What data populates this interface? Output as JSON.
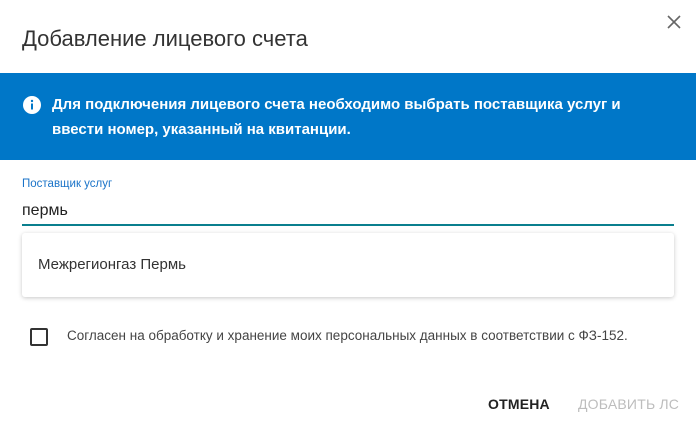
{
  "dialog": {
    "title": "Добавление лицевого счета",
    "info_text": "Для подключения лицевого счета необходимо выбрать поставщика услуг и ввести номер, указанный на квитанции.",
    "provider_field": {
      "label": "Поставщик услуг",
      "value": "пермь"
    },
    "suggestions": [
      {
        "label": "Межрегионгаз Пермь"
      }
    ],
    "consent": {
      "checked": false,
      "label": "Согласен на обработку и хранение моих персональных данных в соответствии с ФЗ-152."
    },
    "buttons": {
      "cancel": "ОТМЕНА",
      "add": "ДОБАВИТЬ ЛС"
    }
  },
  "colors": {
    "banner": "#0077c8",
    "input_underline": "#0a7f8e",
    "label_accent": "#1a73c8",
    "disabled_text": "#bdbdbd"
  },
  "icons": {
    "close": "close-icon",
    "info": "info-icon"
  }
}
